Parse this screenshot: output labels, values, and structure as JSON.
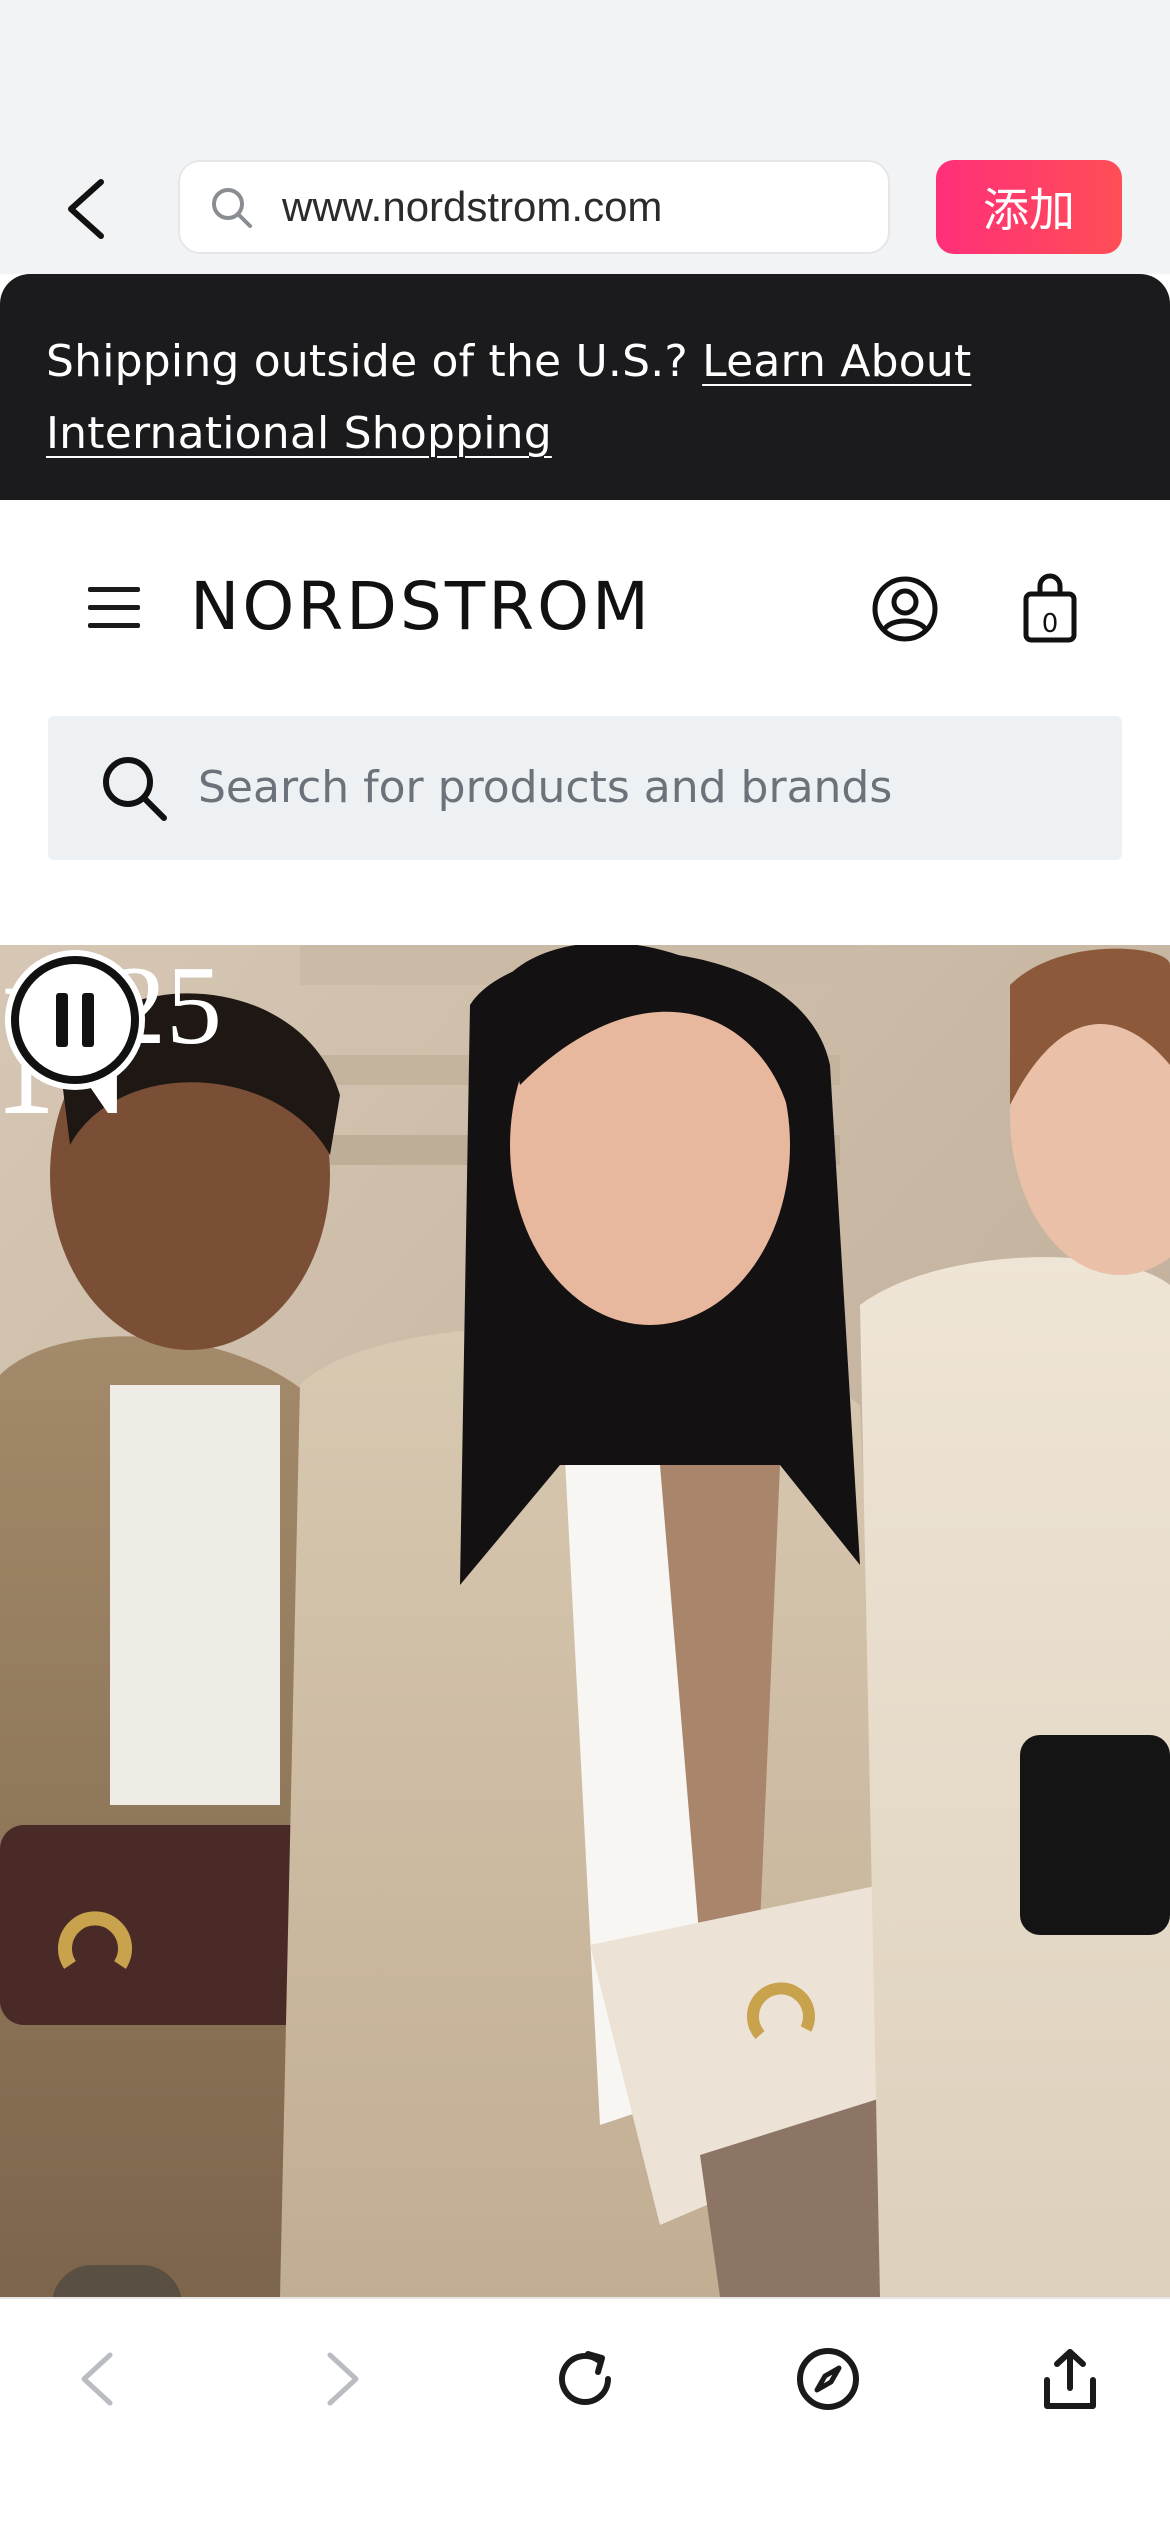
{
  "browser": {
    "url": "www.nordstrom.com",
    "add_label": "添加"
  },
  "banner": {
    "text": "Shipping outside of the U.S.? ",
    "link_text": "Learn About International Shopping"
  },
  "header": {
    "logo": "NORDSTROM",
    "bag_count": "0"
  },
  "search": {
    "placeholder": "Search for products and brands"
  },
  "hero": {
    "badge_text": "25",
    "badge_letter": "N"
  },
  "icons": {
    "back": "chevron-left-icon",
    "url_search": "search-icon",
    "menu": "hamburger-icon",
    "account": "user-circle-icon",
    "bag": "shopping-bag-icon",
    "pause": "pause-icon",
    "toolbar": [
      "back-arrow-icon",
      "forward-arrow-icon",
      "reload-icon",
      "compass-icon",
      "share-icon"
    ]
  },
  "colors": {
    "add_button": "#ff3a6e",
    "banner_bg": "#1b1b1d",
    "search_bg": "#eef1f4"
  }
}
